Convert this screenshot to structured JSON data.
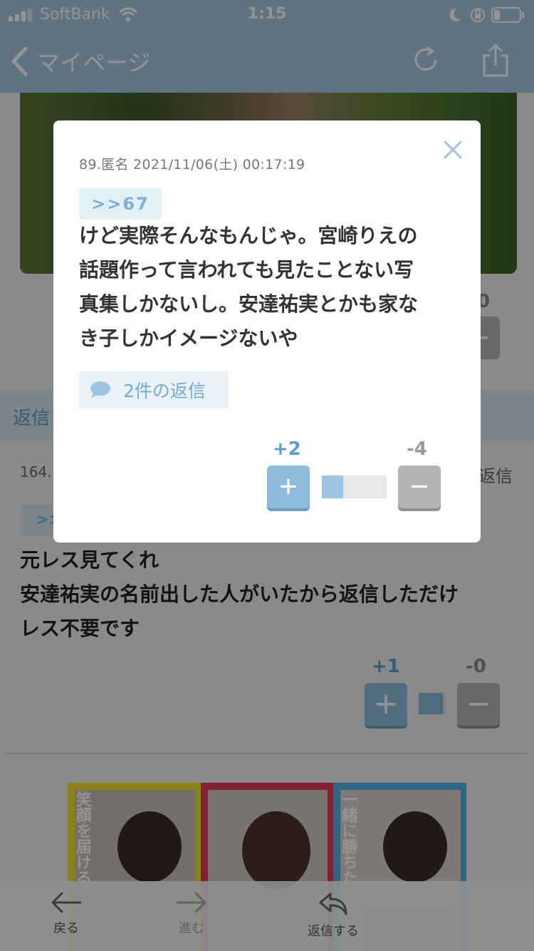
{
  "status_bar": {
    "carrier": "SoftBank",
    "time": "1:15"
  },
  "nav": {
    "back_label": "マイページ"
  },
  "background": {
    "score_partial": "0",
    "reply_strip_label": "返信",
    "meta_partial": "164.",
    "reply_link": "返信",
    "anchor_partial": ">>",
    "body_lines": [
      "元レス見てくれ",
      "安達祐実の名前出した人がいたから返信しただけ",
      "レス不要です"
    ],
    "score_plus": "+1",
    "score_minus": "-0",
    "vote_ratio": 0.9,
    "banner_texts": [
      "笑顔を届ける",
      "一緒に勝ちたい"
    ]
  },
  "modal": {
    "meta": "89.匿名 2021/11/06(土) 00:17:19",
    "anchor": ">>67",
    "body_lines": [
      "けど実際そんなもんじゃ。宮崎りえの",
      "話題作って言われても見たことない写",
      "真集しかないし。安達祐実とかも家な",
      "き子しかイメージないや"
    ],
    "replies_label": "2件の返信",
    "score_plus": "+2",
    "score_minus": "-4",
    "vote_ratio": 0.333,
    "plus_symbol": "+",
    "minus_symbol": "−"
  },
  "toolbar": {
    "back": "戻る",
    "forward": "進む",
    "reply": "返信する"
  },
  "colors": {
    "header": "#a4c6de",
    "accent": "#5b9ccc",
    "plus_button": "#8ebbdc",
    "minus_button": "#b3b3b3"
  }
}
